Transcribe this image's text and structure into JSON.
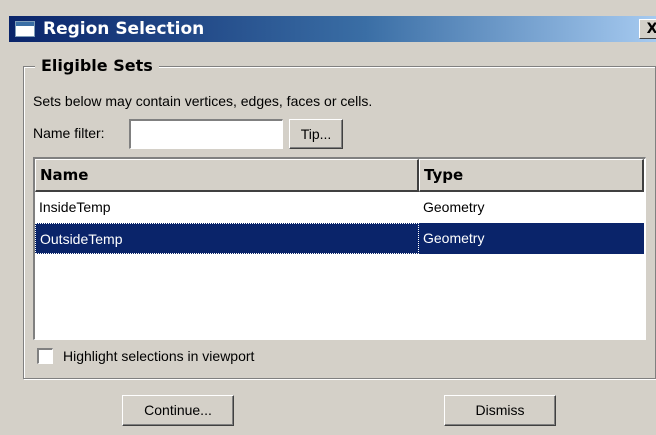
{
  "window": {
    "title": "Region Selection",
    "close_label": "X"
  },
  "group": {
    "title": "Eligible Sets",
    "description": "Sets below may contain vertices, edges, faces or cells."
  },
  "filter": {
    "label": "Name filter:",
    "value": "",
    "tip_label": "Tip..."
  },
  "table": {
    "columns": [
      "Name",
      "Type"
    ],
    "rows": [
      {
        "name": "InsideTemp",
        "type": "Geometry",
        "selected": false
      },
      {
        "name": "OutsideTemp",
        "type": "Geometry",
        "selected": true
      }
    ]
  },
  "highlight": {
    "label": "Highlight selections in viewport",
    "checked": false
  },
  "buttons": {
    "continue": "Continue...",
    "dismiss": "Dismiss"
  },
  "colors": {
    "selection": "#0a246a",
    "face": "#d4d0c8",
    "title_start": "#0a246a",
    "title_end": "#a6caf0"
  }
}
